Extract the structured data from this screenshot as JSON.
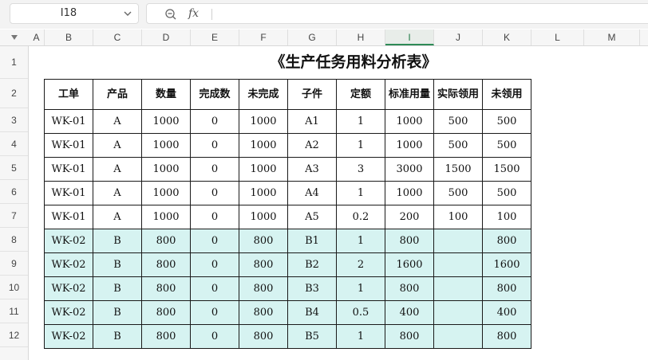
{
  "name_box": "I18",
  "formula": "",
  "columns": [
    "A",
    "B",
    "C",
    "D",
    "E",
    "F",
    "G",
    "H",
    "I",
    "J",
    "K",
    "L",
    "M"
  ],
  "selected_column": "I",
  "rows": [
    "1",
    "2",
    "3",
    "4",
    "5",
    "6",
    "7",
    "8",
    "9",
    "10",
    "11",
    "12"
  ],
  "sheet_title": "《生产任务用料分析表》",
  "table": {
    "headers": [
      "工单",
      "产品",
      "数量",
      "完成数",
      "未完成",
      "子件",
      "定额",
      "标准用量",
      "实际领用",
      "未领用"
    ],
    "rows": [
      [
        "WK-01",
        "A",
        "1000",
        "0",
        "1000",
        "A1",
        "1",
        "1000",
        "500",
        "500"
      ],
      [
        "WK-01",
        "A",
        "1000",
        "0",
        "1000",
        "A2",
        "1",
        "1000",
        "500",
        "500"
      ],
      [
        "WK-01",
        "A",
        "1000",
        "0",
        "1000",
        "A3",
        "3",
        "3000",
        "1500",
        "1500"
      ],
      [
        "WK-01",
        "A",
        "1000",
        "0",
        "1000",
        "A4",
        "1",
        "1000",
        "500",
        "500"
      ],
      [
        "WK-01",
        "A",
        "1000",
        "0",
        "1000",
        "A5",
        "0.2",
        "200",
        "100",
        "100"
      ],
      [
        "WK-02",
        "B",
        "800",
        "0",
        "800",
        "B1",
        "1",
        "800",
        "",
        "800"
      ],
      [
        "WK-02",
        "B",
        "800",
        "0",
        "800",
        "B2",
        "2",
        "1600",
        "",
        "1600"
      ],
      [
        "WK-02",
        "B",
        "800",
        "0",
        "800",
        "B3",
        "1",
        "800",
        "",
        "800"
      ],
      [
        "WK-02",
        "B",
        "800",
        "0",
        "800",
        "B4",
        "0.5",
        "400",
        "",
        "400"
      ],
      [
        "WK-02",
        "B",
        "800",
        "0",
        "800",
        "B5",
        "1",
        "800",
        "",
        "800"
      ]
    ]
  },
  "colors": {
    "group_b_fill": "#d6f3f1",
    "selected_header": "#2e8b57"
  },
  "icons": {
    "zoom": "zoom-out-icon",
    "fx": "fx-icon",
    "dropdown": "chevron-down-icon"
  }
}
